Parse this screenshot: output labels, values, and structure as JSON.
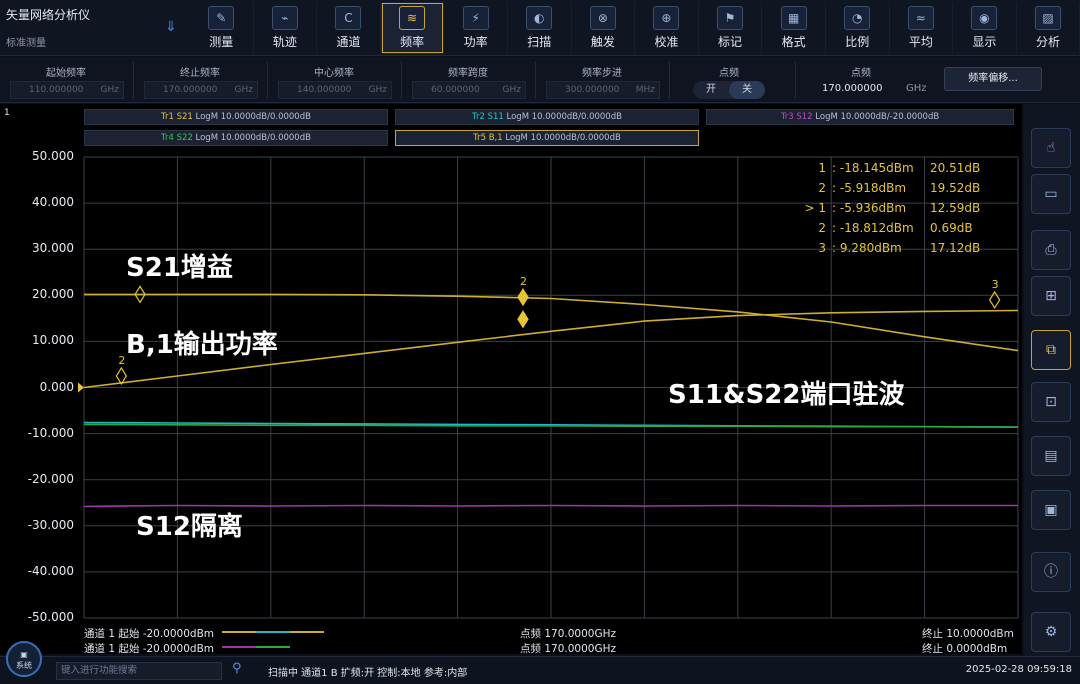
{
  "app": {
    "title": "矢量网络分析仪",
    "subtitle": "标准测量"
  },
  "toolbar": [
    "测量",
    "轨迹",
    "通道",
    "频率",
    "功率",
    "扫描",
    "触发",
    "校准",
    "标记",
    "格式",
    "比例",
    "平均",
    "显示",
    "分析"
  ],
  "toolbar_icons": [
    "measure-icon",
    "trace-icon",
    "channel-icon",
    "frequency-icon",
    "power-icon",
    "sweep-icon",
    "trigger-icon",
    "calibrate-icon",
    "marker-icon",
    "format-icon",
    "scale-icon",
    "average-icon",
    "display-icon",
    "analysis-icon"
  ],
  "toolbar_active": "频率",
  "params": {
    "start": {
      "label": "起始频率",
      "value": "110.000000",
      "unit": "GHz"
    },
    "stop": {
      "label": "终止频率",
      "value": "170.000000",
      "unit": "GHz"
    },
    "center": {
      "label": "中心频率",
      "value": "140.000000",
      "unit": "GHz"
    },
    "span": {
      "label": "频率跨度",
      "value": "60.000000",
      "unit": "GHz"
    },
    "step": {
      "label": "频率步进",
      "value": "300.000000",
      "unit": "MHz"
    },
    "cw_toggle": {
      "label": "点频",
      "on": "开",
      "off": "关"
    },
    "cw": {
      "label": "点频",
      "value": "170.000000",
      "unit": "GHz"
    },
    "offset_button": "频率偏移..."
  },
  "traces": [
    {
      "label": "Tr1 S21 LogM 10.0000dB/0.0000dB",
      "color": "#e7c338"
    },
    {
      "label": "Tr2 S11 LogM 10.0000dB/0.0000dB",
      "color": "#28c6c6"
    },
    {
      "label": "Tr3 S12 LogM 10.0000dB/-20.0000dB",
      "color": "#c04ac8"
    },
    {
      "label": "Tr4 S22 LogM 10.0000dB/0.0000dB",
      "color": "#35c84a"
    },
    {
      "label": "Tr5 B,1 LogM 10.0000dB/0.0000dB",
      "color": "#e7c338"
    }
  ],
  "y_ticks": [
    "50.000",
    "40.000",
    "30.000",
    "20.000",
    "10.000",
    "0.000",
    "-10.000",
    "-20.000",
    "-30.000",
    "-40.000",
    "-50.000"
  ],
  "markers": [
    {
      "id": "1",
      "value": ": -18.145dBm",
      "db": "20.51dB"
    },
    {
      "id": "2",
      "value": ": -5.918dBm",
      "db": "19.52dB"
    },
    {
      "id": "> 1",
      "value": ": -5.936dBm",
      "db": "12.59dB"
    },
    {
      "id": "2",
      "value": ": -18.812dBm",
      "db": "0.69dB"
    },
    {
      "id": "3",
      "value": ": 9.280dBm",
      "db": "17.12dB"
    }
  ],
  "marker_flags": [
    "2",
    "2",
    "3"
  ],
  "annotations": {
    "s21": "S21增益",
    "b1": "B,1输出功率",
    "s11s22": "S11&S22端口驻波",
    "s12": "S12隔离"
  },
  "chart_data": {
    "type": "line",
    "ylim": [
      -50,
      50
    ],
    "x": [
      0,
      0.1,
      0.2,
      0.3,
      0.4,
      0.5,
      0.6,
      0.7,
      0.8,
      0.9,
      1.0
    ],
    "series": [
      {
        "name": "S21",
        "color": "#cfae2e",
        "values": [
          20.2,
          20.2,
          20.2,
          20.1,
          19.8,
          19.3,
          18.0,
          16.4,
          14.2,
          11.0,
          8.0
        ]
      },
      {
        "name": "B,1",
        "color": "#cfae2e",
        "values": [
          0.0,
          2.5,
          5.0,
          7.4,
          9.8,
          12.2,
          14.4,
          15.6,
          16.2,
          16.5,
          16.7
        ]
      },
      {
        "name": "S11",
        "color": "#1fb9c1",
        "values": [
          -7.6,
          -7.7,
          -7.8,
          -7.9,
          -8.0,
          -8.1,
          -8.2,
          -8.3,
          -8.4,
          -8.5,
          -8.6
        ]
      },
      {
        "name": "S22",
        "color": "#2aa844",
        "values": [
          -8.0,
          -8.1,
          -8.2,
          -8.2,
          -8.3,
          -8.3,
          -8.4,
          -8.4,
          -8.5,
          -8.5,
          -8.6
        ]
      },
      {
        "name": "S12",
        "color": "#9d37a8",
        "values": [
          -25.8,
          -25.6,
          -25.7,
          -25.6,
          -25.7,
          -25.6,
          -25.7,
          -25.6,
          -25.7,
          -25.6,
          -25.6
        ]
      }
    ],
    "grid": true
  },
  "channel": {
    "row1_left": "通道 1 起始 -20.0000dBm",
    "row1_mid": "点频 170.0000GHz",
    "row1_right": "终止 10.0000dBm",
    "row2_left": "通道 1 起始 -20.0000dBm",
    "row2_mid": "点频 170.0000GHz",
    "row2_right": "终止 0.0000dBm"
  },
  "status": {
    "system": "系统",
    "search_placeholder": "键入进行功能搜索",
    "text": "扫描中 通道1 B 扩频:开 控制:本地 参考:内部",
    "datetime": "2025-02-28 09:59:18"
  },
  "rightbar_icons": [
    "touch-icon",
    "scpi-icon",
    "print-icon",
    "save-icon",
    "recall-icon",
    "preset-icon",
    "file-icon",
    "config-icon",
    "info-icon",
    "settings-icon"
  ]
}
